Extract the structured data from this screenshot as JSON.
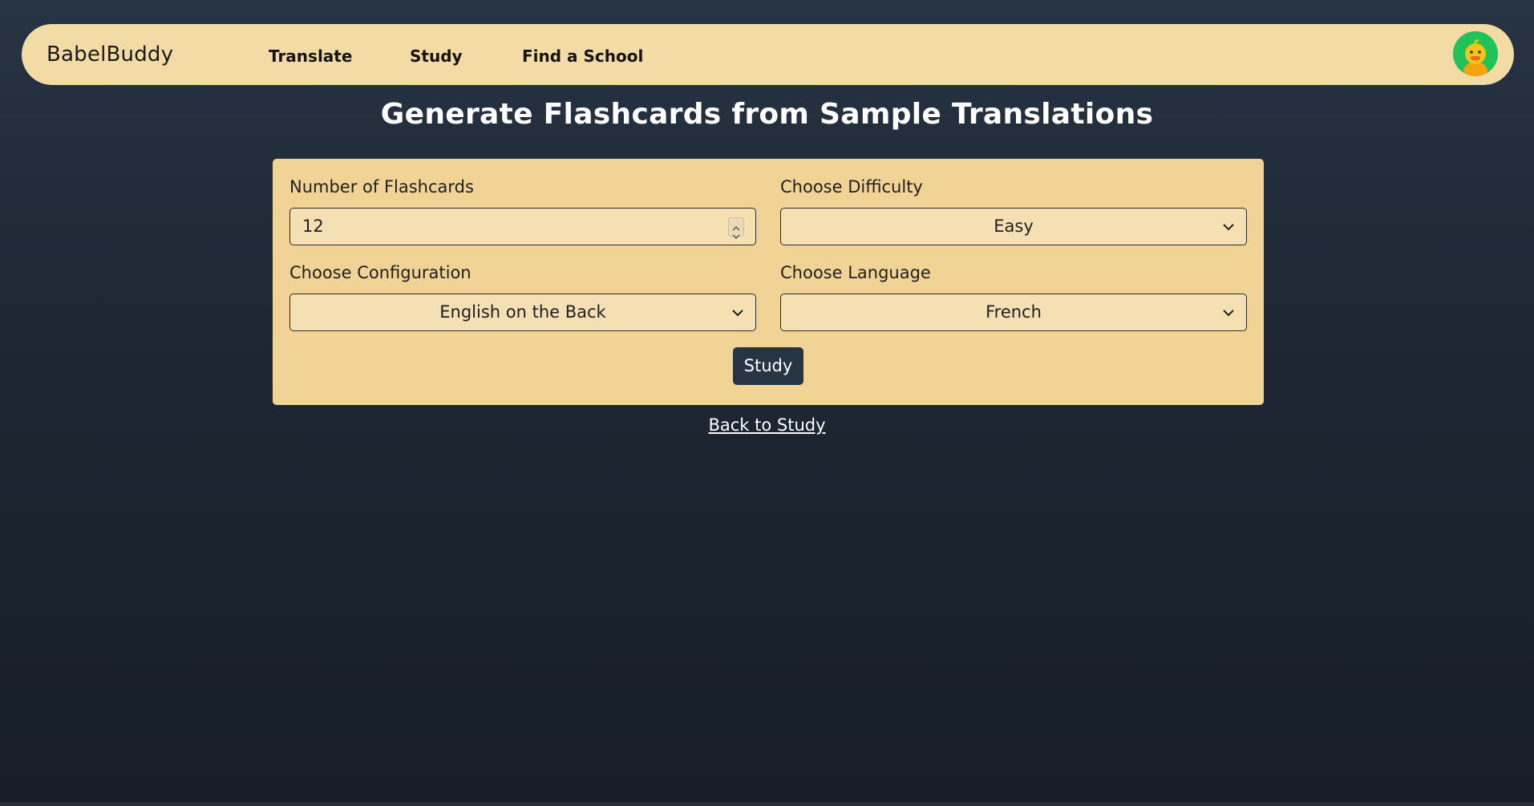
{
  "nav": {
    "brand": "BabelBuddy",
    "links": [
      "Translate",
      "Study",
      "Find a School"
    ],
    "avatar_icon": "duck-avatar-icon"
  },
  "page": {
    "title": "Generate Flashcards from Sample Translations"
  },
  "form": {
    "flashcards": {
      "label": "Number of Flashcards",
      "value": "12"
    },
    "difficulty": {
      "label": "Choose Difficulty",
      "value": "Easy"
    },
    "configuration": {
      "label": "Choose Configuration",
      "value": "English on the Back"
    },
    "language": {
      "label": "Choose Language",
      "value": "French"
    },
    "submit_label": "Study"
  },
  "back_link": "Back to Study",
  "colors": {
    "nav_bg": "#f3dba6",
    "card_bg": "#f1d495",
    "field_bg": "#f4e0b3",
    "button_bg": "#263443",
    "avatar_bg": "#21c25a"
  }
}
